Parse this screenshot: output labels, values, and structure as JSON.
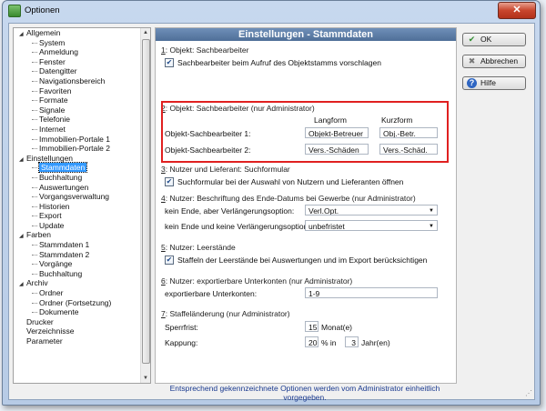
{
  "window": {
    "title": "Optionen",
    "close": "✕"
  },
  "tree": [
    {
      "level": 0,
      "label": "Allgemein",
      "expanded": true
    },
    {
      "level": 1,
      "label": "System"
    },
    {
      "level": 1,
      "label": "Anmeldung"
    },
    {
      "level": 1,
      "label": "Fenster"
    },
    {
      "level": 1,
      "label": "Datengitter"
    },
    {
      "level": 1,
      "label": "Navigationsbereich"
    },
    {
      "level": 1,
      "label": "Favoriten"
    },
    {
      "level": 1,
      "label": "Formate"
    },
    {
      "level": 1,
      "label": "Signale"
    },
    {
      "level": 1,
      "label": "Telefonie"
    },
    {
      "level": 1,
      "label": "Internet"
    },
    {
      "level": 1,
      "label": "Immobilien-Portale 1"
    },
    {
      "level": 1,
      "label": "Immobilien-Portale 2"
    },
    {
      "level": 0,
      "label": "Einstellungen",
      "expanded": true
    },
    {
      "level": 1,
      "label": "Stammdaten",
      "selected": true
    },
    {
      "level": 1,
      "label": "Buchhaltung"
    },
    {
      "level": 1,
      "label": "Auswertungen"
    },
    {
      "level": 1,
      "label": "Vorgangsverwaltung"
    },
    {
      "level": 1,
      "label": "Historien"
    },
    {
      "level": 1,
      "label": "Export"
    },
    {
      "level": 1,
      "label": "Update"
    },
    {
      "level": 0,
      "label": "Farben",
      "expanded": true
    },
    {
      "level": 1,
      "label": "Stammdaten 1"
    },
    {
      "level": 1,
      "label": "Stammdaten 2"
    },
    {
      "level": 1,
      "label": "Vorgänge"
    },
    {
      "level": 1,
      "label": "Buchhaltung"
    },
    {
      "level": 0,
      "label": "Archiv",
      "expanded": true
    },
    {
      "level": 1,
      "label": "Ordner"
    },
    {
      "level": 1,
      "label": "Ordner (Fortsetzung)"
    },
    {
      "level": 1,
      "label": "Dokumente"
    },
    {
      "level": 0,
      "label": "Drucker"
    },
    {
      "level": 0,
      "label": "Verzeichnisse"
    },
    {
      "level": 0,
      "label": "Parameter"
    }
  ],
  "panel": {
    "header": "Einstellungen - Stammdaten",
    "g1": {
      "num": "1",
      "title": ": Objekt: Sachbearbeiter",
      "check": "Sachbearbeiter beim Aufruf des Objektstamms vorschlagen"
    },
    "g2": {
      "num": "2",
      "title": ": Objekt: Sachbearbeiter  (nur Administrator)",
      "col_long": "Langform",
      "col_short": "Kurzform",
      "row1_label": "Objekt-Sachbearbeiter 1:",
      "row1_long": "Objekt-Betreuer",
      "row1_short": "Obj.-Betr.",
      "row2_label": "Objekt-Sachbearbeiter 2:",
      "row2_long": "Vers.-Schäden",
      "row2_short": "Vers.-Schäd."
    },
    "g3": {
      "num": "3",
      "title": ": Nutzer und Lieferant: Suchformular",
      "check": "Suchformular bei der Auswahl von Nutzern und Lieferanten öffnen"
    },
    "g4": {
      "num": "4",
      "title": ": Nutzer: Beschriftung des Ende-Datums bei Gewerbe  (nur Administrator)",
      "row1_label": "kein Ende, aber Verlängerungsoption:",
      "row1_value": "Verl.Opt.",
      "row2_label": "kein Ende und keine Verlängerungsoption:",
      "row2_value": "unbefristet"
    },
    "g5": {
      "num": "5",
      "title": ": Nutzer: Leerstände",
      "check": "Staffeln der Leerstände bei Auswertungen und im Export berücksichtigen"
    },
    "g6": {
      "num": "6",
      "title": ": Nutzer: exportierbare Unterkonten  (nur Administrator)",
      "label": "exportierbare Unterkonten:",
      "value": "1-9"
    },
    "g7": {
      "num": "7",
      "title": ": Staffeländerung  (nur Administrator)",
      "sperr_label": "Sperrfrist:",
      "sperr_value": "15",
      "sperr_unit": "Monat(e)",
      "kapp_label": "Kappung:",
      "kapp_value": "20",
      "kapp_mid": "% in",
      "kapp_years": "3",
      "kapp_unit": "Jahr(en)"
    },
    "footer": "Entsprechend gekennzeichnete Optionen werden vom Administrator einheitlich vorgegeben."
  },
  "buttons": {
    "ok": "OK",
    "cancel": "Abbrechen",
    "help": "Hilfe"
  },
  "colors": {
    "accent_header": "#5f7fa8",
    "highlight_box": "#e02020",
    "selection": "#3399ff"
  }
}
